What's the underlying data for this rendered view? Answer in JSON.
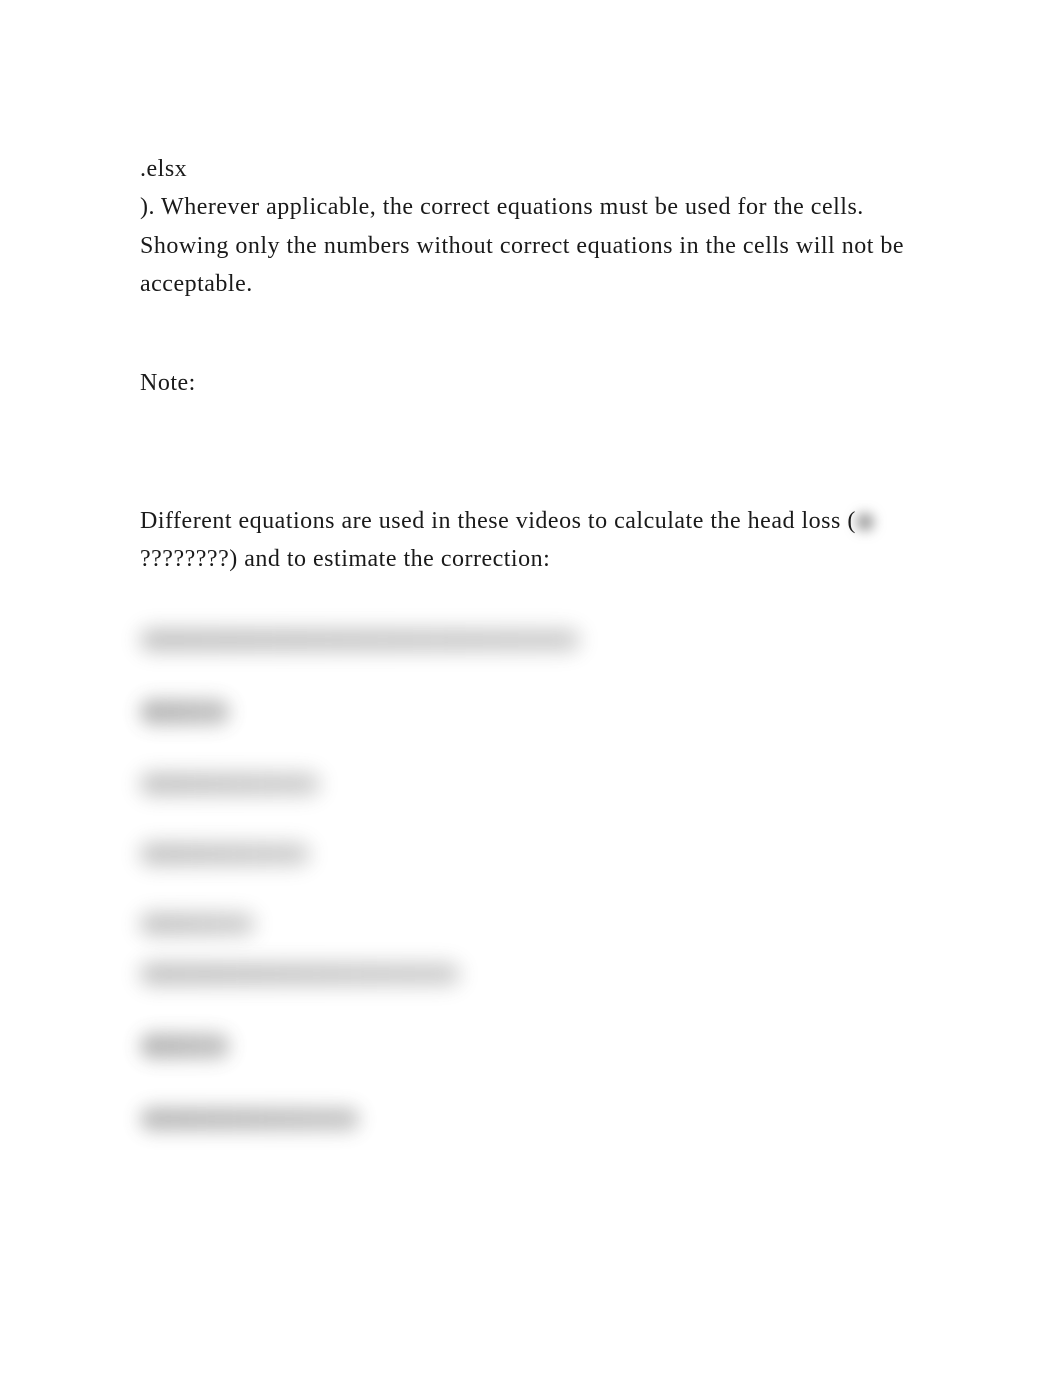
{
  "document": {
    "line1": ".elsx",
    "line2": "). Wherever applicable, the correct equations must be used for the cells.",
    "line3": "Showing only the numbers without correct equations in the cells will not be acceptable.",
    "note_label": "Note:",
    "paragraph2_part1": "Different equations are used in these videos to calculate the head loss (",
    "paragraph2_masked": "????????",
    "paragraph2_part2": ") and to estimate the correction:"
  }
}
